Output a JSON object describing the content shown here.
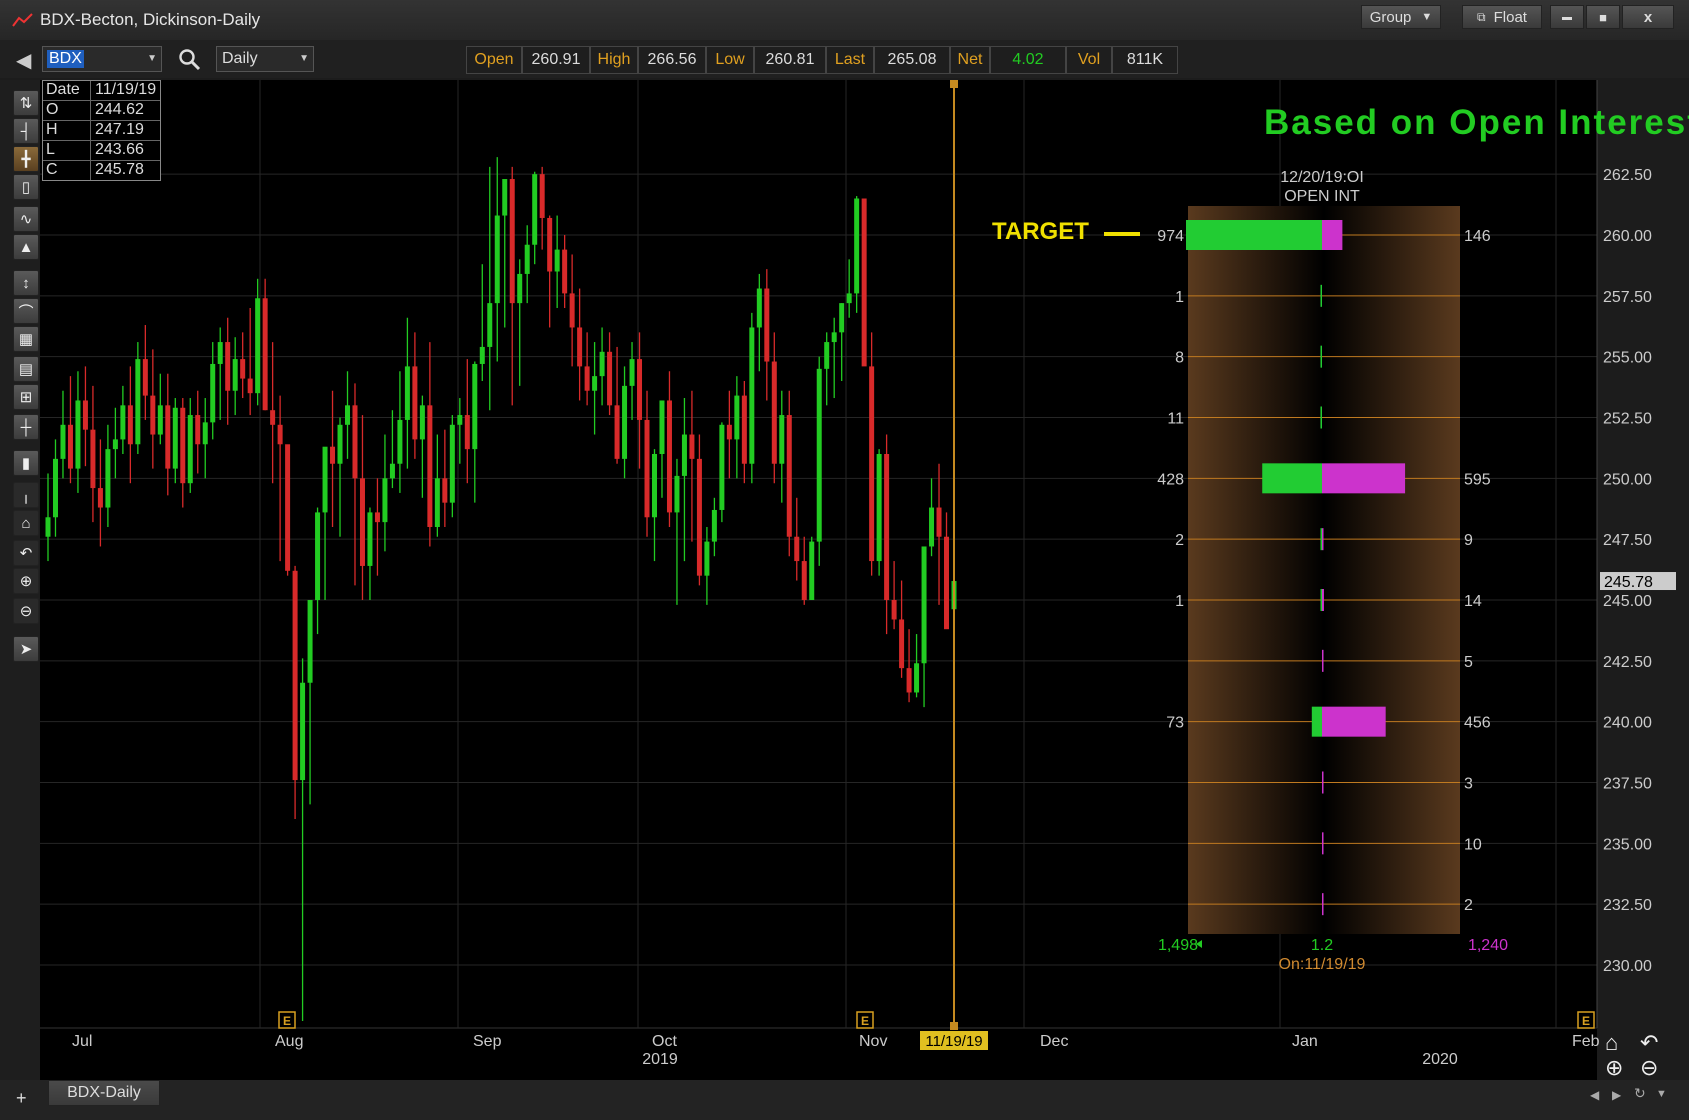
{
  "window": {
    "title": "BDX-Becton, Dickinson-Daily",
    "group_label": "Group",
    "float_label": "Float",
    "minimize": "▬",
    "maximize": "■",
    "close": "x"
  },
  "toolbar": {
    "symbol": "BDX",
    "interval": "Daily",
    "quote": [
      {
        "label": "Open",
        "value": "260.91",
        "color": "#dcdcdc"
      },
      {
        "label": "High",
        "value": "266.56",
        "color": "#dcdcdc"
      },
      {
        "label": "Low",
        "value": "260.81",
        "color": "#dcdcdc"
      },
      {
        "label": "Last",
        "value": "265.08",
        "color": "#dcdcdc"
      },
      {
        "label": "Net",
        "value": "4.02",
        "color": "#22cc22"
      },
      {
        "label": "Vol",
        "value": "811K",
        "color": "#dcdcdc"
      }
    ]
  },
  "ohlc_box": [
    {
      "k": "Date",
      "v": "11/19/19"
    },
    {
      "k": "O",
      "v": "244.62"
    },
    {
      "k": "H",
      "v": "247.19"
    },
    {
      "k": "L",
      "v": "243.66"
    },
    {
      "k": "C",
      "v": "245.78"
    }
  ],
  "bottom": {
    "tab_label": "BDX-Daily",
    "plus": "+"
  },
  "colors": {
    "up": "#22cc22",
    "down": "#d82a2a",
    "call": "#22cc33",
    "put": "#cc33cc",
    "accent": "#e0a020"
  },
  "chart_data": {
    "type": "candlestick",
    "y_axis": {
      "min": 227.5,
      "max": 265.0,
      "step": 2.5,
      "ticks": [
        "262.50",
        "260.00",
        "257.50",
        "255.00",
        "252.50",
        "250.00",
        "247.50",
        "245.00",
        "242.50",
        "240.00",
        "237.50",
        "235.00",
        "232.50",
        "230.00"
      ],
      "last_price_label": "245.78"
    },
    "x_axis": {
      "month_labels": [
        "Jul",
        "Aug",
        "Sep",
        "Oct",
        "Nov",
        "Dec",
        "Jan",
        "Feb"
      ],
      "year_labels": [
        "2019",
        "2020"
      ],
      "cursor_label": "11/19/19"
    },
    "earnings_markers": [
      "E",
      "E",
      "E"
    ],
    "candles": [
      [
        247.6,
        250.2,
        246.6,
        248.4
      ],
      [
        248.4,
        251.6,
        247.6,
        250.8
      ],
      [
        250.8,
        253.6,
        250.0,
        252.2
      ],
      [
        252.2,
        254.2,
        249.8,
        250.4
      ],
      [
        250.4,
        254.4,
        249.4,
        253.2
      ],
      [
        253.2,
        254.6,
        250.5,
        252.0
      ],
      [
        252.0,
        253.8,
        248.2,
        249.6
      ],
      [
        249.6,
        251.6,
        247.2,
        248.8
      ],
      [
        248.8,
        252.2,
        248.0,
        251.2
      ],
      [
        251.2,
        252.9,
        250.0,
        251.6
      ],
      [
        251.6,
        253.8,
        251.0,
        253.0
      ],
      [
        253.0,
        254.6,
        249.8,
        251.4
      ],
      [
        251.4,
        255.6,
        251.0,
        254.9
      ],
      [
        254.9,
        256.3,
        252.4,
        253.4
      ],
      [
        253.4,
        255.3,
        250.4,
        251.8
      ],
      [
        251.8,
        254.3,
        251.4,
        253.0
      ],
      [
        253.0,
        254.3,
        249.3,
        250.4
      ],
      [
        250.4,
        253.3,
        249.8,
        252.9
      ],
      [
        252.9,
        253.3,
        248.8,
        249.8
      ],
      [
        249.8,
        253.3,
        249.4,
        252.6
      ],
      [
        252.6,
        253.6,
        250.2,
        251.4
      ],
      [
        251.4,
        253.3,
        250.0,
        252.3
      ],
      [
        252.3,
        255.6,
        251.6,
        254.7
      ],
      [
        254.7,
        256.2,
        252.4,
        255.6
      ],
      [
        255.6,
        256.6,
        252.2,
        253.6
      ],
      [
        253.6,
        255.8,
        252.6,
        254.9
      ],
      [
        254.9,
        256.0,
        253.3,
        254.1
      ],
      [
        254.1,
        257.0,
        252.6,
        253.5
      ],
      [
        253.5,
        258.2,
        253.0,
        257.4
      ],
      [
        257.4,
        258.2,
        252.8,
        252.8
      ],
      [
        252.8,
        255.6,
        249.8,
        252.2
      ],
      [
        252.2,
        253.4,
        246.6,
        251.4
      ],
      [
        251.4,
        250.0,
        246.0,
        246.2
      ],
      [
        246.2,
        246.4,
        236.0,
        237.6
      ],
      [
        237.6,
        242.6,
        227.7,
        241.6
      ],
      [
        241.6,
        245.0,
        236.6,
        245.0
      ],
      [
        245.0,
        248.8,
        243.6,
        248.6
      ],
      [
        248.6,
        251.2,
        245.0,
        251.3
      ],
      [
        251.3,
        253.6,
        248.0,
        250.6
      ],
      [
        250.6,
        252.5,
        247.6,
        252.2
      ],
      [
        252.2,
        254.4,
        250.8,
        253.0
      ],
      [
        253.0,
        253.9,
        245.6,
        250.0
      ],
      [
        250.0,
        252.6,
        245.0,
        246.4
      ],
      [
        246.4,
        248.8,
        245.0,
        248.6
      ],
      [
        248.6,
        250.0,
        246.0,
        248.2
      ],
      [
        248.2,
        251.8,
        247.0,
        250.0
      ],
      [
        250.0,
        252.8,
        249.6,
        250.6
      ],
      [
        250.6,
        254.4,
        249.4,
        252.4
      ],
      [
        252.4,
        256.6,
        250.4,
        254.6
      ],
      [
        254.6,
        256.0,
        250.8,
        251.6
      ],
      [
        251.6,
        253.4,
        249.2,
        253.0
      ],
      [
        253.0,
        255.6,
        247.2,
        248.0
      ],
      [
        248.0,
        251.8,
        247.6,
        250.0
      ],
      [
        250.0,
        252.0,
        248.0,
        249.0
      ],
      [
        249.0,
        252.6,
        248.4,
        252.2
      ],
      [
        252.2,
        253.3,
        250.6,
        252.6
      ],
      [
        252.6,
        254.9,
        249.8,
        251.2
      ],
      [
        251.2,
        254.8,
        249.0,
        254.7
      ],
      [
        254.7,
        258.8,
        254.0,
        255.4
      ],
      [
        255.4,
        262.8,
        252.8,
        257.2
      ],
      [
        257.2,
        263.2,
        254.8,
        260.8
      ],
      [
        260.8,
        262.2,
        256.2,
        262.3
      ],
      [
        262.3,
        262.8,
        253.0,
        257.2
      ],
      [
        257.2,
        259.0,
        253.8,
        258.4
      ],
      [
        258.4,
        260.4,
        257.2,
        259.6
      ],
      [
        259.6,
        262.6,
        258.8,
        262.5
      ],
      [
        262.5,
        262.8,
        259.4,
        260.7
      ],
      [
        260.7,
        260.8,
        256.2,
        258.5
      ],
      [
        258.5,
        260.8,
        257.0,
        259.4
      ],
      [
        259.4,
        260.0,
        257.0,
        257.6
      ],
      [
        257.6,
        259.2,
        254.6,
        256.2
      ],
      [
        256.2,
        257.8,
        253.2,
        254.6
      ],
      [
        254.6,
        256.0,
        253.0,
        253.6
      ],
      [
        253.6,
        255.6,
        251.8,
        254.2
      ],
      [
        254.2,
        256.2,
        253.0,
        255.2
      ],
      [
        255.2,
        256.0,
        252.6,
        253.0
      ],
      [
        253.0,
        255.4,
        250.6,
        250.8
      ],
      [
        250.8,
        254.6,
        250.0,
        253.8
      ],
      [
        253.8,
        255.6,
        252.4,
        254.9
      ],
      [
        254.9,
        256.0,
        250.4,
        252.4
      ],
      [
        252.4,
        253.6,
        247.6,
        248.4
      ],
      [
        248.4,
        251.2,
        246.6,
        251.0
      ],
      [
        251.0,
        253.2,
        249.2,
        253.2
      ],
      [
        253.2,
        254.4,
        248.0,
        248.6
      ],
      [
        248.6,
        250.8,
        244.8,
        250.1
      ],
      [
        250.1,
        253.3,
        246.6,
        251.8
      ],
      [
        251.8,
        253.6,
        247.4,
        250.8
      ],
      [
        250.8,
        251.8,
        245.6,
        246.0
      ],
      [
        246.0,
        248.0,
        244.8,
        247.4
      ],
      [
        247.4,
        249.2,
        246.8,
        248.7
      ],
      [
        248.7,
        252.3,
        248.2,
        252.2
      ],
      [
        252.2,
        253.6,
        250.0,
        251.6
      ],
      [
        251.6,
        254.2,
        250.0,
        253.4
      ],
      [
        253.4,
        254.0,
        249.8,
        250.6
      ],
      [
        250.6,
        256.8,
        249.8,
        256.2
      ],
      [
        256.2,
        258.4,
        254.4,
        257.8
      ],
      [
        257.8,
        258.6,
        253.2,
        254.8
      ],
      [
        254.8,
        256.0,
        249.8,
        250.6
      ],
      [
        250.6,
        253.6,
        249.0,
        252.6
      ],
      [
        252.6,
        253.6,
        246.8,
        247.6
      ],
      [
        247.6,
        249.2,
        245.8,
        246.6
      ],
      [
        246.6,
        247.6,
        244.8,
        245.0
      ],
      [
        245.0,
        247.6,
        245.0,
        247.4
      ],
      [
        247.4,
        255.0,
        246.4,
        254.5
      ],
      [
        254.5,
        256.0,
        253.0,
        255.6
      ],
      [
        255.6,
        256.6,
        253.3,
        256.0
      ],
      [
        256.0,
        257.2,
        254.0,
        257.2
      ],
      [
        257.2,
        259.0,
        256.6,
        257.6
      ],
      [
        257.6,
        261.6,
        256.8,
        261.5
      ],
      [
        261.5,
        260.6,
        254.8,
        254.6
      ],
      [
        254.6,
        256.0,
        246.0,
        246.6
      ],
      [
        246.6,
        251.2,
        246.0,
        251.0
      ],
      [
        251.0,
        251.8,
        243.6,
        245.0
      ],
      [
        245.0,
        246.6,
        243.8,
        244.2
      ],
      [
        244.2,
        245.8,
        241.8,
        242.2
      ],
      [
        242.2,
        243.8,
        240.8,
        241.2
      ],
      [
        241.2,
        243.6,
        241.0,
        242.4
      ],
      [
        242.4,
        247.2,
        240.6,
        247.2
      ],
      [
        247.2,
        250.0,
        246.8,
        248.8
      ],
      [
        248.8,
        250.6,
        244.8,
        247.6
      ],
      [
        247.6,
        248.6,
        244.0,
        243.8
      ],
      [
        244.62,
        247.19,
        243.66,
        245.78
      ]
    ],
    "open_interest": {
      "title": "Based on Open Interest Levels",
      "header_line1": "12/20/19:OI",
      "header_line2": "OPEN INT",
      "target_label": "TARGET",
      "strikes": [
        {
          "price": 260.0,
          "calls": 974,
          "puts": 146,
          "call_label": "974",
          "put_label": "146"
        },
        {
          "price": 257.5,
          "calls": 1,
          "puts": 0,
          "call_label": "1",
          "put_label": ""
        },
        {
          "price": 255.0,
          "calls": 8,
          "puts": 0,
          "call_label": "8",
          "put_label": ""
        },
        {
          "price": 252.5,
          "calls": 11,
          "puts": 0,
          "call_label": "11",
          "put_label": ""
        },
        {
          "price": 250.0,
          "calls": 428,
          "puts": 595,
          "call_label": "428",
          "put_label": "595"
        },
        {
          "price": 247.5,
          "calls": 2,
          "puts": 9,
          "call_label": "2",
          "put_label": "9"
        },
        {
          "price": 245.0,
          "calls": 1,
          "puts": 14,
          "call_label": "1",
          "put_label": "14"
        },
        {
          "price": 242.5,
          "calls": 0,
          "puts": 5,
          "call_label": "",
          "put_label": "5"
        },
        {
          "price": 240.0,
          "calls": 73,
          "puts": 456,
          "call_label": "73",
          "put_label": "456"
        },
        {
          "price": 237.5,
          "calls": 0,
          "puts": 3,
          "call_label": "",
          "put_label": "3"
        },
        {
          "price": 235.0,
          "calls": 0,
          "puts": 10,
          "call_label": "",
          "put_label": "10"
        },
        {
          "price": 232.5,
          "calls": 0,
          "puts": 2,
          "call_label": "",
          "put_label": "2"
        }
      ],
      "total_calls": "1,498",
      "ratio": "1.2",
      "total_puts": "1,240",
      "as_of": "On:11/19/19"
    }
  }
}
